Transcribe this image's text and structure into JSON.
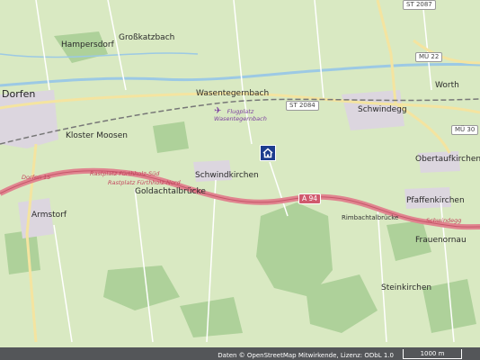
{
  "map": {
    "places": [
      {
        "id": "dorfen",
        "name": "Dorfen"
      },
      {
        "id": "hampersdorf",
        "name": "Hampersdorf"
      },
      {
        "id": "grosskatzbach",
        "name": "Großkatzbach"
      },
      {
        "id": "wasentegernbach",
        "name": "Wasentegernbach"
      },
      {
        "id": "kloster-moosen",
        "name": "Kloster Moosen"
      },
      {
        "id": "schwindkirchen",
        "name": "Schwindkirchen"
      },
      {
        "id": "goldachtalbrucke",
        "name": "Goldachtalbrücke"
      },
      {
        "id": "armstorf",
        "name": "Armstorf"
      },
      {
        "id": "schwindegg",
        "name": "Schwindegg"
      },
      {
        "id": "worth",
        "name": "Worth"
      },
      {
        "id": "obertaufkirchen",
        "name": "Obertaufkirchen"
      },
      {
        "id": "pfaffenkirchen",
        "name": "Pfaffenkirchen"
      },
      {
        "id": "rimbachtalbrucke",
        "name": "Rimbachtalbrücke"
      },
      {
        "id": "frauenornau",
        "name": "Frauenornau"
      },
      {
        "id": "steinkirchen",
        "name": "Steinkirchen"
      }
    ],
    "roads": {
      "st2084": "ST 2084",
      "st2087": "ST 2087",
      "mu22": "MÜ 22",
      "mu30": "MÜ 30",
      "a94": "A 94",
      "ed15": "Dorfen 15"
    },
    "rest_areas": {
      "sud": "Rastplatz Fürthholz-Süd",
      "nord": "Rastplatz Fürthholz-Nord",
      "schwindegg": "Schwindegg"
    },
    "airport": {
      "line1": "Flugplatz",
      "line2": "Wasentegernbach"
    },
    "marker": {
      "icon": "home-icon"
    }
  },
  "footer": {
    "attribution": "Daten © OpenStreetMap Mitwirkende, Lizenz: ODbL 1.0",
    "scale": "1000 m"
  },
  "colors": {
    "land": "#d9e9c2",
    "forest": "#aed19a",
    "motorway": "#e0848f",
    "road": "#f4e4a0",
    "river": "#9cc9e4",
    "rail": "#777777",
    "urban": "#dcd6df",
    "marker": "#1d3d8f"
  }
}
